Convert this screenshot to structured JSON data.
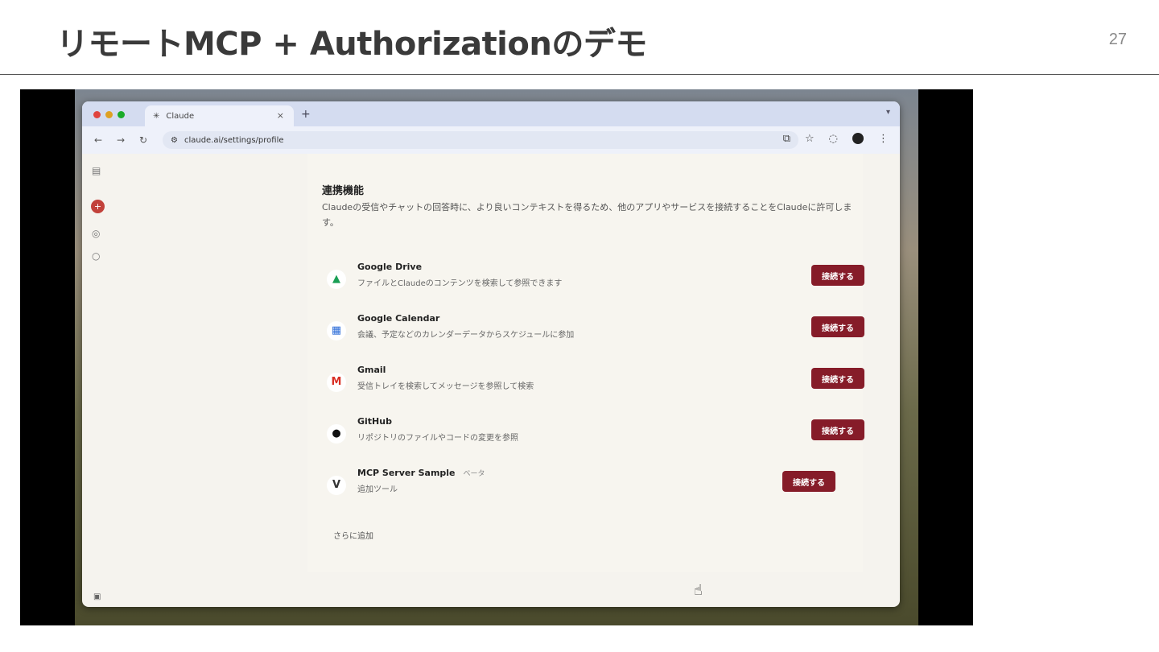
{
  "slide": {
    "title": "リモートMCP + Authorizationのデモ",
    "page_number": "27"
  },
  "browser": {
    "tab_title": "Claude",
    "url": "claude.ai/settings/profile"
  },
  "settings": {
    "section_title": "連携機能",
    "section_description": "Claudeの受信やチャットの回答時に、より良いコンテキストを得るため、他のアプリやサービスを接続することをClaudeに許可します。",
    "integrations": [
      {
        "name": "Google Drive",
        "description": "ファイルとClaudeのコンテンツを検索して参照できます",
        "button": "接続する",
        "icon": "google-drive-icon"
      },
      {
        "name": "Google Calendar",
        "description": "会議、予定などのカレンダーデータからスケジュールに参加",
        "button": "接続する",
        "icon": "google-calendar-icon"
      },
      {
        "name": "Gmail",
        "description": "受信トレイを検索してメッセージを参照して検索",
        "button": "接続する",
        "icon": "gmail-icon"
      },
      {
        "name": "GitHub",
        "description": "リポジトリのファイルやコードの変更を参照",
        "button": "接続する",
        "icon": "github-icon"
      },
      {
        "name": "MCP Server Sample",
        "tag": "ベータ",
        "description": "追加ツール",
        "button": "接続する",
        "icon": "mcp-server-icon"
      }
    ],
    "more_link": "さらに追加"
  }
}
